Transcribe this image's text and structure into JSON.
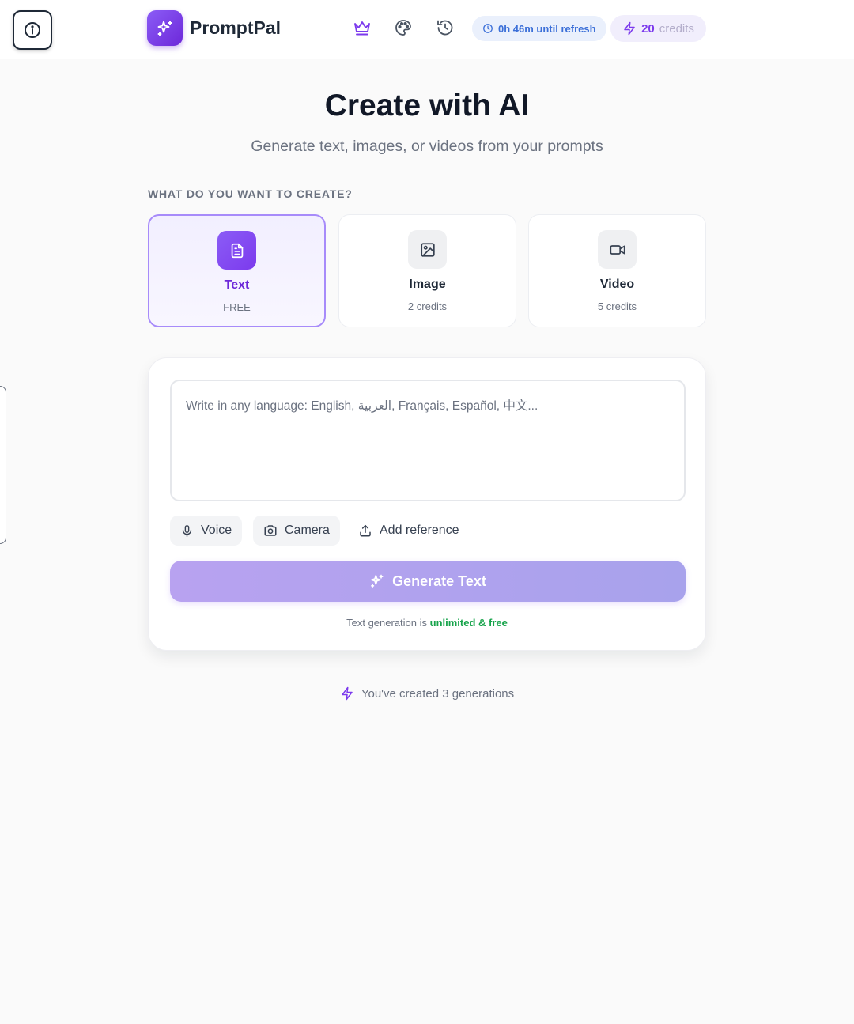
{
  "header": {
    "brand": "PromptPal",
    "refresh_text": "0h 46m until refresh",
    "credits_count": "20",
    "credits_label": "credits",
    "icons": [
      "crown-icon",
      "palette-icon",
      "history-icon"
    ]
  },
  "hero": {
    "title": "Create with AI",
    "subtitle": "Generate text, images, or videos from your prompts"
  },
  "create_section": {
    "label": "WHAT DO YOU WANT TO CREATE?",
    "types": [
      {
        "name": "Text",
        "cost": "FREE",
        "icon": "document-icon",
        "selected": true
      },
      {
        "name": "Image",
        "cost": "2 credits",
        "icon": "image-icon",
        "selected": false
      },
      {
        "name": "Video",
        "cost": "5 credits",
        "icon": "video-camera-icon",
        "selected": false
      }
    ]
  },
  "composer": {
    "placeholder": "Write in any language: English, العربية, Français, Español, 中文...",
    "voice_label": "Voice",
    "camera_label": "Camera",
    "reference_label": "Add reference",
    "generate_label": "Generate Text",
    "note_prefix": "Text generation is",
    "note_highlight": "unlimited & free"
  },
  "footer": {
    "generations_text": "You've created 3 generations"
  },
  "colors": {
    "accent": "#7c3aed",
    "refresh_text": "#3b6fd8",
    "success": "#16a34a",
    "background": "#fafafa"
  }
}
